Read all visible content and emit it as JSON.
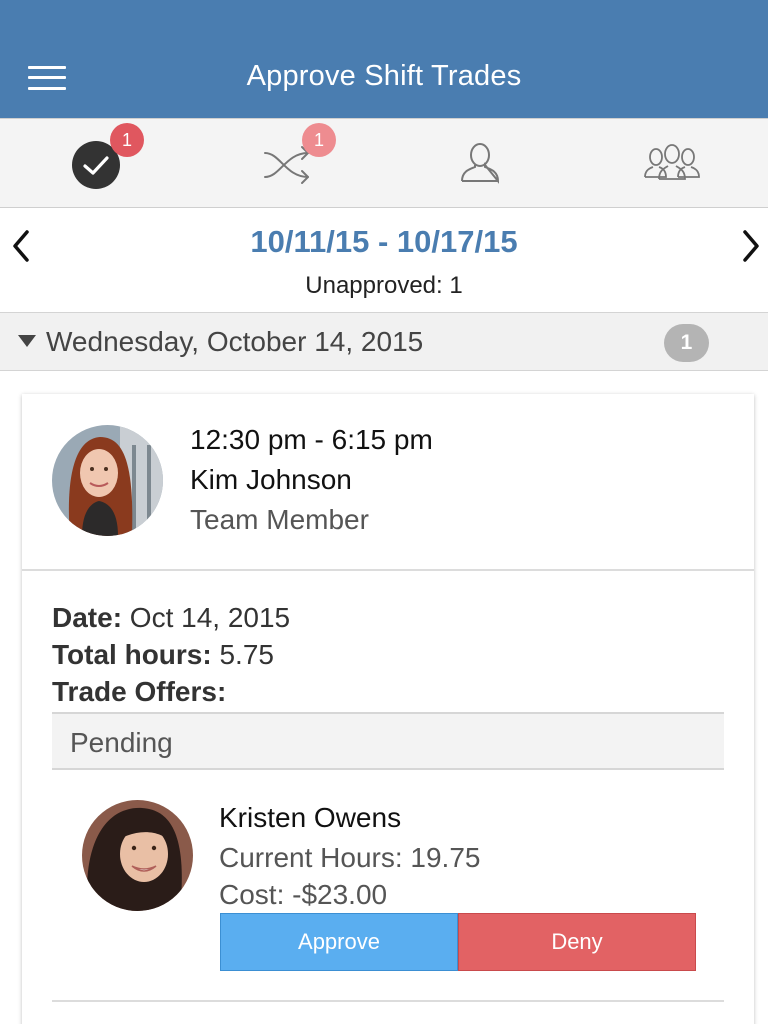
{
  "header": {
    "title": "Approve Shift Trades",
    "menu_icon": "hamburger-menu-icon",
    "background": "#4a7db0"
  },
  "tabs": [
    {
      "icon": "check-circle-icon",
      "badge": "1"
    },
    {
      "icon": "shuffle-icon",
      "badge": "1"
    },
    {
      "icon": "person-icon",
      "badge": null
    },
    {
      "icon": "group-icon",
      "badge": null
    }
  ],
  "date_nav": {
    "range": "10/11/15 - 10/17/15",
    "unapproved": "Unapproved: 1",
    "prev_icon": "chevron-left-icon",
    "next_icon": "chevron-right-icon"
  },
  "day": {
    "label": "Wednesday, October 14, 2015",
    "count": "1",
    "expanded": true
  },
  "shift": {
    "time": "12:30 pm - 6:15 pm",
    "employee": "Kim Johnson",
    "role": "Team Member",
    "date_label": "Date:",
    "date_value": "Oct 14, 2015",
    "hours_label": "Total hours:",
    "hours_value": "5.75",
    "offers_label": "Trade Offers:"
  },
  "offers": {
    "section_label": "Pending",
    "items": [
      {
        "name": "Kristen Owens",
        "current_hours": "Current Hours: 19.75",
        "cost": "Cost: -$23.00",
        "approve_label": "Approve",
        "deny_label": "Deny"
      }
    ]
  },
  "colors": {
    "accent": "#4a7db0",
    "badge": "#e0575f",
    "approve": "#5aaef0",
    "deny": "#e26264"
  }
}
